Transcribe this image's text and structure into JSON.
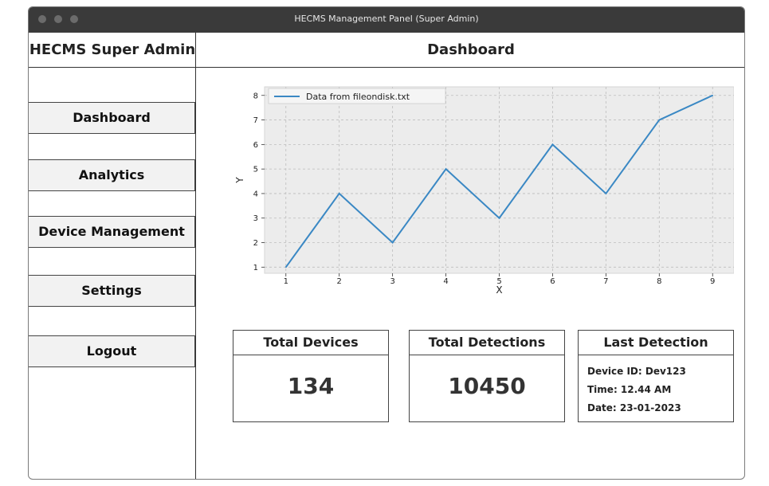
{
  "window": {
    "title": "HECMS Management Panel (Super Admin)"
  },
  "sidebar": {
    "brand": "HECMS Super Admin",
    "items": [
      {
        "label": "Dashboard"
      },
      {
        "label": "Analytics"
      },
      {
        "label": "Device Management"
      },
      {
        "label": "Settings"
      },
      {
        "label": "Logout"
      }
    ]
  },
  "main": {
    "title": "Dashboard",
    "cards": {
      "devices": {
        "title": "Total Devices",
        "value": "134"
      },
      "detections": {
        "title": "Total Detections",
        "value": "10450"
      },
      "last": {
        "title": "Last Detection",
        "device": "Device ID: Dev123",
        "time": "Time: 12.44 AM",
        "date": "Date: 23-01-2023"
      }
    }
  },
  "chart_data": {
    "type": "line",
    "title": "",
    "xlabel": "X",
    "ylabel": "Y",
    "x": [
      1,
      2,
      3,
      4,
      5,
      6,
      7,
      8,
      9
    ],
    "series": [
      {
        "name": "Data from fileondisk.txt",
        "values": [
          1,
          4,
          2,
          5,
          3,
          6,
          4,
          7,
          8
        ],
        "color": "#3a88c4"
      }
    ],
    "xlim": [
      0.6,
      9.4
    ],
    "ylim": [
      0.75,
      8.35
    ],
    "xticks": [
      "1",
      "2",
      "3",
      "4",
      "5",
      "6",
      "7",
      "8",
      "9"
    ],
    "yticks": [
      "1",
      "2",
      "3",
      "4",
      "5",
      "6",
      "7",
      "8"
    ],
    "grid": true,
    "legend": "top-left",
    "background": "#ececec"
  }
}
